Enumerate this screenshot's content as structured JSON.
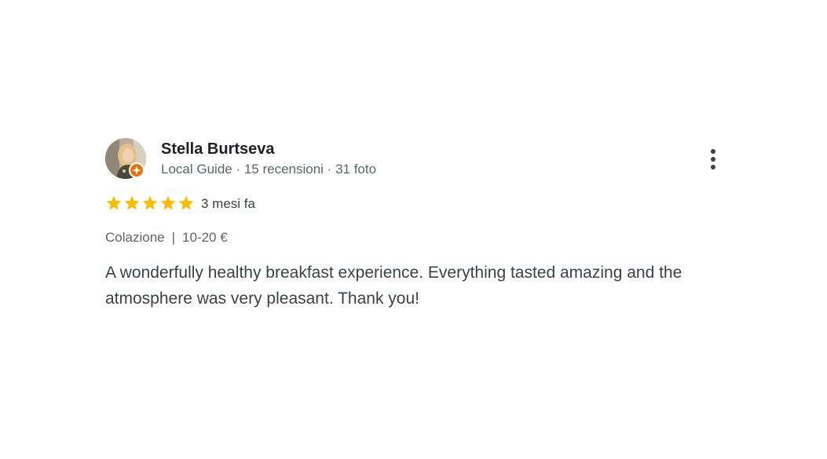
{
  "reviewer": {
    "name": "Stella Burtseva",
    "meta": "Local Guide · 15 recensioni · 31 foto"
  },
  "rating": {
    "stars": 5,
    "date": "3 mesi fa"
  },
  "attributes": {
    "category": "Colazione",
    "separator": "|",
    "price": "10-20 €"
  },
  "review": {
    "text": "A wonderfully healthy breakfast experience. Everything tasted amazing and the atmosphere was very pleasant. Thank you!"
  },
  "colors": {
    "star": "#fbbc04",
    "badge": "#e8710a",
    "text": "#3c4043",
    "muted": "#5f6368"
  },
  "icons": {
    "more": "more-vert-icon",
    "star": "star-icon",
    "badge": "local-guide-badge-icon"
  }
}
